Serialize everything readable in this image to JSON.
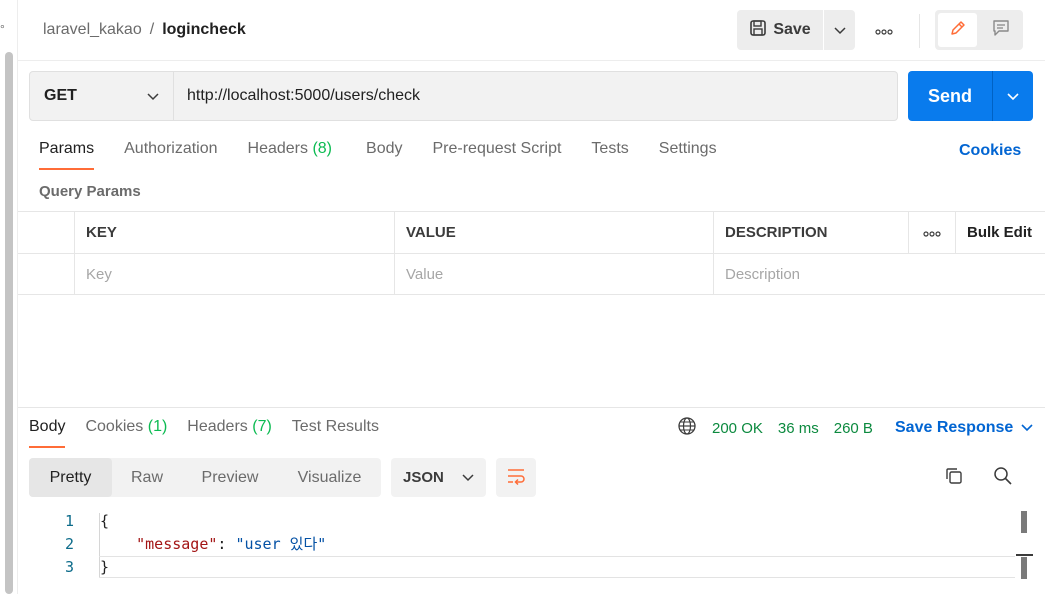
{
  "breadcrumb": {
    "collection": "laravel_kakao",
    "separator": "/",
    "request": "logincheck"
  },
  "toolbar": {
    "save_label": "Save"
  },
  "request": {
    "method": "GET",
    "url": "http://localhost:5000/users/check",
    "send_label": "Send"
  },
  "request_tabs": [
    {
      "label": "Params",
      "count": ""
    },
    {
      "label": "Authorization",
      "count": ""
    },
    {
      "label": "Headers",
      "count": "(8)"
    },
    {
      "label": "Body",
      "count": ""
    },
    {
      "label": "Pre-request Script",
      "count": ""
    },
    {
      "label": "Tests",
      "count": ""
    },
    {
      "label": "Settings",
      "count": ""
    }
  ],
  "cookies_link": "Cookies",
  "query_params": {
    "label": "Query Params",
    "headers": {
      "key": "KEY",
      "value": "VALUE",
      "description": "DESCRIPTION",
      "bulk_edit": "Bulk Edit"
    },
    "placeholders": {
      "key": "Key",
      "value": "Value",
      "description": "Description"
    }
  },
  "response_tabs": [
    {
      "label": "Body",
      "count": ""
    },
    {
      "label": "Cookies",
      "count": "(1)"
    },
    {
      "label": "Headers",
      "count": "(7)"
    },
    {
      "label": "Test Results",
      "count": ""
    }
  ],
  "response_meta": {
    "status": "200 OK",
    "time": "36 ms",
    "size": "260 B",
    "save_response": "Save Response"
  },
  "view_modes": [
    "Pretty",
    "Raw",
    "Preview",
    "Visualize"
  ],
  "format": "JSON",
  "code": {
    "line_numbers": [
      "1",
      "2",
      "3"
    ],
    "open_brace": "{",
    "indent": "    ",
    "key": "\"message\"",
    "colon": ": ",
    "value": "\"user 있다\"",
    "close_brace": "}"
  },
  "colors": {
    "accent_orange": "#ff6c37",
    "send_blue": "#097bed",
    "link_blue": "#0265d2",
    "status_green": "#0c8a3f"
  },
  "icons": [
    "save-icon",
    "chevron-down-icon",
    "more-horizontal-icon",
    "edit-pencil-icon",
    "comment-icon",
    "globe-icon",
    "wrap-lines-icon",
    "copy-icon",
    "search-icon"
  ]
}
